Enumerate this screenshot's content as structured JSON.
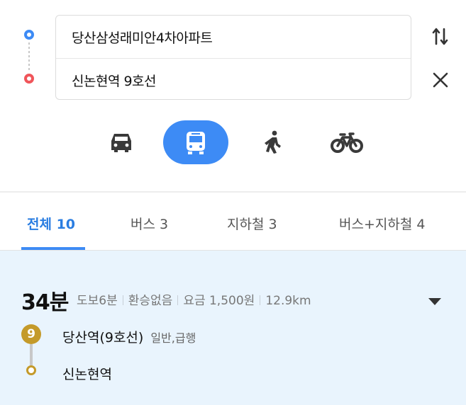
{
  "route_inputs": {
    "origin": "당산삼성래미안4차아파트",
    "destination": "신논현역 9호선"
  },
  "modes": [
    {
      "name": "car",
      "icon": "car-icon",
      "selected": false
    },
    {
      "name": "bus",
      "icon": "bus-icon",
      "selected": true
    },
    {
      "name": "walk",
      "icon": "walk-icon",
      "selected": false
    },
    {
      "name": "bike",
      "icon": "bike-icon",
      "selected": false
    }
  ],
  "tabs": [
    {
      "label": "전체 10",
      "active": true
    },
    {
      "label": "버스 3",
      "active": false
    },
    {
      "label": "지하철 3",
      "active": false
    },
    {
      "label": "버스+지하철 4",
      "active": false
    }
  ],
  "result": {
    "duration": "34분",
    "walk": "도보6분",
    "transfer": "환승없음",
    "fare": "요금 1,500원",
    "distance": "12.9km",
    "line_badge": "9",
    "start_station": "당산역(9호선)",
    "train_type": "일반,급행",
    "end_station": "신논현역"
  },
  "colors": {
    "accent": "#3d8bf5",
    "origin_dot": "#3d8bf5",
    "destination_dot": "#f0555a",
    "line9": "#c49a2a",
    "result_bg": "#e9f4fd"
  }
}
